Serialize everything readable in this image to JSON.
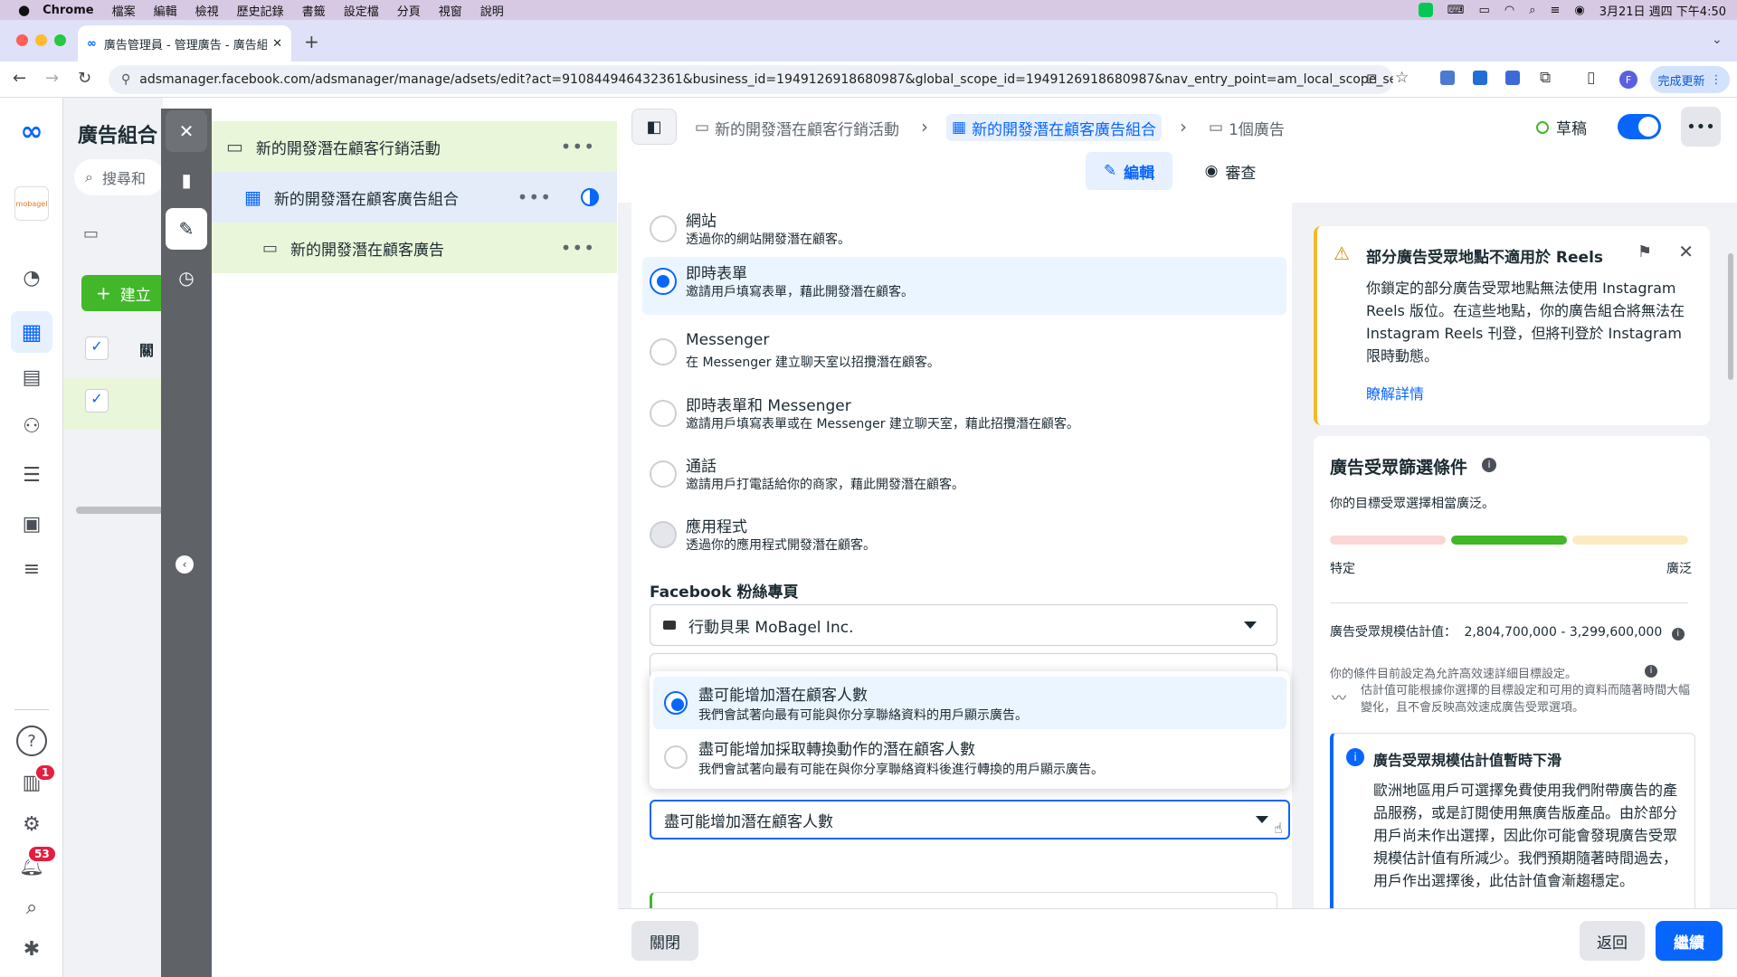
{
  "menubar": {
    "items": [
      "Chrome",
      "檔案",
      "編輯",
      "檢視",
      "歷史記錄",
      "書籤",
      "設定檔",
      "分頁",
      "視窗",
      "說明"
    ],
    "datetime": "3月21日 週四 下午4:50"
  },
  "browser": {
    "tab_title": "廣告管理員 - 管理廣告 - 廣告組",
    "url": "adsmanager.facebook.com/adsmanager/manage/adsets/edit?act=910844946432361&business_id=1949126918680987&global_scope_id=1949126918680987&nav_entry_point=am_local_scope_selec...",
    "update_button": "完成更新",
    "profile_initial": "F"
  },
  "rail": {
    "brand_label": "mobagel",
    "notif_badge_1": "1",
    "notif_badge_2": "53",
    "help": "?"
  },
  "background": {
    "title": "廣告組合",
    "search_placeholder": "搜尋和",
    "create_button": "建立",
    "col_header": "關"
  },
  "tree": {
    "campaign": "新的開發潛在顧客行銷活動",
    "adset": "新的開發潛在顧客廣告組合",
    "ad": "新的開發潛在顧客廣告"
  },
  "breadcrumb": {
    "campaign": "新的開發潛在顧客行銷活動",
    "adset": "新的開發潛在顧客廣告組合",
    "ads": "1個廣告",
    "status": "草稿",
    "edit": "編輯",
    "review": "審查"
  },
  "options": [
    {
      "title": "網站",
      "desc": "透過你的網站開發潛在顧客。"
    },
    {
      "title": "即時表單",
      "desc": "邀請用戶填寫表單，藉此開發潛在顧客。"
    },
    {
      "title": "Messenger",
      "desc": "在 Messenger 建立聊天室以招攬潛在顧客。"
    },
    {
      "title": "即時表單和 Messenger",
      "desc": "邀請用戶填寫表單或在 Messenger 建立聊天室，藉此招攬潛在顧客。"
    },
    {
      "title": "通話",
      "desc": "邀請用戶打電話給你的商家，藉此開發潛在顧客。"
    },
    {
      "title": "應用程式",
      "desc": "透過你的應用程式開發潛在顧客。"
    }
  ],
  "fb_page": {
    "label": "Facebook 粉絲專頁",
    "value": "行動貝果 MoBagel Inc."
  },
  "goal_dropdown": {
    "options": [
      {
        "title": "盡可能增加潛在顧客人數",
        "desc": "我們會試著向最有可能與你分享聯絡資料的用戶顯示廣告。"
      },
      {
        "title": "盡可能增加採取轉換動作的潛在顧客人數",
        "desc": "我們會試著向最有可能在與你分享聯絡資料後進行轉換的用戶顯示廣告。"
      }
    ],
    "selected": "盡可能增加潛在顧客人數"
  },
  "warning_card": {
    "title": "部分廣告受眾地點不適用於 Reels",
    "body": "你鎖定的部分廣告受眾地點無法使用 Instagram Reels 版位。在這些地點，你的廣告組合將無法在 Instagram Reels 刊登，但將刊登於 Instagram 限時動態。",
    "link": "瞭解詳情"
  },
  "audience_card": {
    "title": "廣告受眾篩選條件",
    "subtitle": "你的目標受眾選擇相當廣泛。",
    "specific": "特定",
    "broad": "廣泛",
    "estimate_label": "廣告受眾規模估計值：",
    "estimate_value": "2,804,700,000 - 3,299,600,000",
    "note1": "你的條件目前設定為允許高效速詳細目標設定。",
    "note2": "估計值可能根據你選擇的目標設定和可用的資料而隨著時間大幅變化，且不會反映高效速成廣告受眾選項。",
    "info_title": "廣告受眾規模估計值暫時下滑",
    "info_body": "歐洲地區用戶可選擇免費使用我們附帶廣告的產品服務，或是訂閱使用無廣告版產品。由於部分用戶尚未作出選擇，因此你可能會發現廣告受眾規模估計值有所減少。我們預期隨著時間過去，用戶作出選擇後，此估計值會漸趨穩定。"
  },
  "bottom": {
    "close": "關閉",
    "back": "返回",
    "continue": "繼續"
  },
  "colors": {
    "accent": "#0866ff",
    "selected_bg": "#ebf5ff",
    "tree_bg": "#eaf6d9",
    "warning": "#f7b928",
    "meter_green": "#42b72a"
  }
}
